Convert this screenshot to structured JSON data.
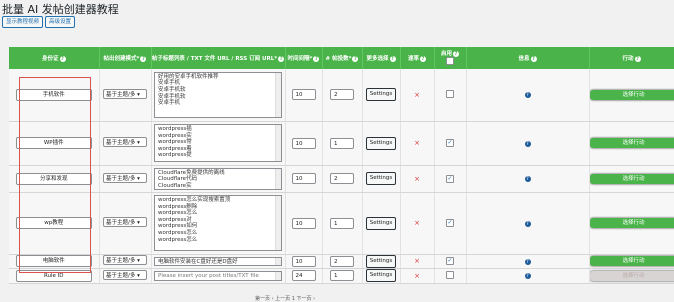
{
  "page": {
    "title": "批量 AI 发帖创建器教程",
    "btn_show_tutorial": "显示教程视频",
    "btn_advanced": "高级设置"
  },
  "headers": {
    "identity": "身份证",
    "mode": "帖出创建模式*",
    "titles_list": "帖子标题列表 / TXT 文件 URL / RSS 订阅 URL*",
    "interval": "时间间隔*",
    "count": "# 帖投数*",
    "more": "更多选择",
    "rate": "速率",
    "activate": "启用",
    "info": "信息",
    "action": "行动"
  },
  "rows": [
    {
      "name": "手机软件",
      "mode": "基于主题/多",
      "lines": [
        "好用的安卓手机软件推荐",
        "安卓手机",
        "安卓手机软",
        "安卓手机软",
        "安卓手机"
      ],
      "interval": "10",
      "count": "2",
      "settings": "Settings",
      "rate": "×",
      "checked": false,
      "action": "选择行动"
    },
    {
      "name": "WP插件",
      "mode": "基于主题/多",
      "lines": [
        "wordpress插",
        "wordpress实",
        "wordpress常",
        "wordpress着",
        "wordpress提"
      ],
      "interval": "10",
      "count": "1",
      "settings": "Settings",
      "rate": "×",
      "checked": true,
      "action": "选择行动"
    },
    {
      "name": "分享和发现",
      "mode": "基于主题/多",
      "lines": [
        "Cloudflare免费提供的离线",
        "Cloudflare代码",
        "Cloudflare实"
      ],
      "interval": "10",
      "count": "2",
      "settings": "Settings",
      "rate": "×",
      "checked": true,
      "action": "选择行动"
    },
    {
      "name": "wp教程",
      "mode": "基于主题/多",
      "lines": [
        "wordpress怎么实现搜索置顶",
        "wordpress删除",
        "wordpress怎么",
        "wordpress对",
        "wordpress如何",
        "wordpress怎么",
        "wordpress怎么"
      ],
      "interval": "10",
      "count": "1",
      "settings": "Settings",
      "rate": "×",
      "checked": true,
      "action": "选择行动"
    },
    {
      "name": "电脑软件",
      "mode": "基于主题/多",
      "lines": [
        "电脑软件安装在C盘好还是D盘好"
      ],
      "interval": "10",
      "count": "2",
      "settings": "Settings",
      "rate": "×",
      "checked": true,
      "action": "选择行动"
    },
    {
      "name": "Rule ID",
      "mode": "基于主题/多",
      "lines": [
        "Please insert your post titles/TXT file"
      ],
      "interval": "24",
      "count": "1",
      "settings": "Settings",
      "rate": "×",
      "checked": false,
      "action": "选择行动"
    }
  ],
  "pager": {
    "text": "第一页 ‹ 上一页 1 下一页 ›"
  }
}
